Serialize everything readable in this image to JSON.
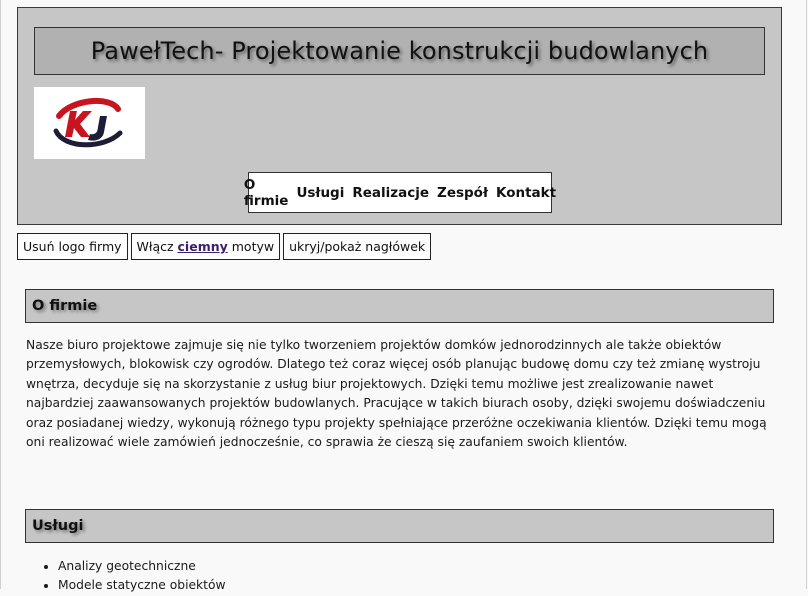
{
  "header": {
    "title": "PawełTech- Projektowanie konstrukcji budowlanych",
    "logo_icon": "kj-logo-icon",
    "nav": [
      "O firmie",
      "Usługi",
      "Realizacje",
      "Zespół",
      "Kontakt"
    ]
  },
  "toolbar": {
    "remove_logo": "Usuń logo firmy",
    "theme_prefix": "Włącz ",
    "theme_highlight": "ciemny",
    "theme_suffix": " motyw",
    "toggle_header": "ukryj/pokaż nagłówek"
  },
  "about": {
    "heading": "O firmie",
    "text": "Nasze biuro projektowe zajmuje się nie tylko tworzeniem projektów domków jednorodzinnych ale także obiektów przemysłowych, blokowisk czy ogrodów. Dlatego też coraz więcej osób planując budowę domu czy też zmianę wystroju wnętrza, decyduje się na skorzystanie z usług biur projektowych. Dzięki temu możliwe jest zrealizowanie nawet najbardziej zaawansowanych projektów budowlanych. Pracujące w takich biurach osoby, dzięki swojemu doświadczeniu oraz posiadanej wiedzy, wykonują różnego typu projekty spełniające przeróżne oczekiwania klientów. Dzięki temu mogą oni realizować wiele zamówień jednocześnie, co sprawia że cieszą się zaufaniem swoich klientów."
  },
  "services": {
    "heading": "Usługi",
    "items": [
      "Analizy geotechniczne",
      "Modele statyczne obiektów"
    ]
  },
  "colors": {
    "header_bg": "#c6c6c6",
    "title_bg": "#b1b1b1",
    "logo_red": "#c8141e",
    "logo_dark": "#1d1d35",
    "theme_link": "#3a1f6b"
  }
}
